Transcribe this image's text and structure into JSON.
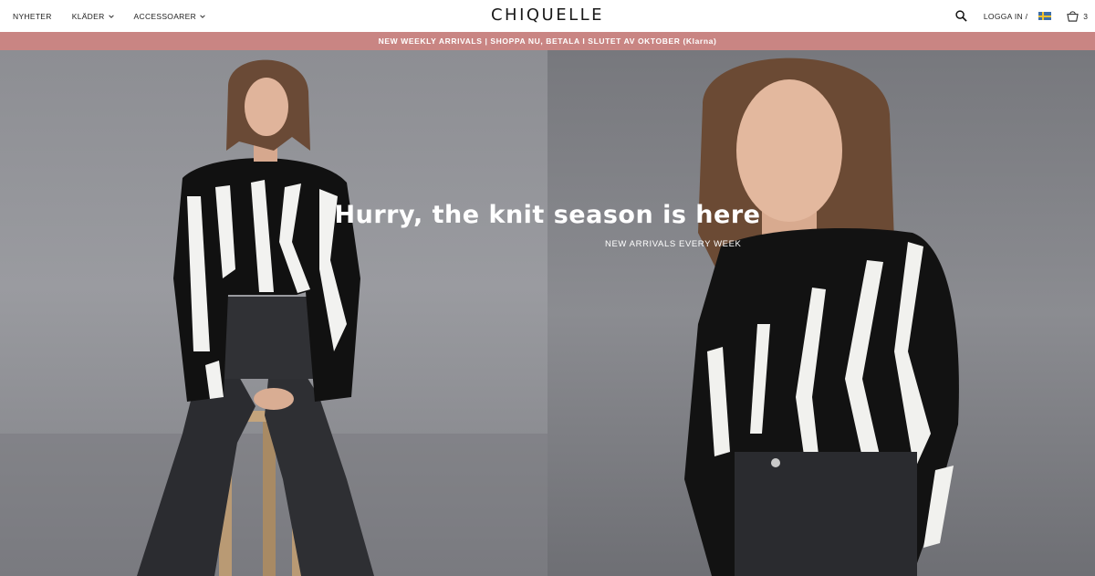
{
  "nav": {
    "items": [
      {
        "label": "NYHETER",
        "has_dropdown": false
      },
      {
        "label": "KLÄDER",
        "has_dropdown": true
      },
      {
        "label": "ACCESSOARER",
        "has_dropdown": true
      }
    ]
  },
  "brand": {
    "logo": "CHIQUELLE"
  },
  "tools": {
    "search_icon": "search-icon",
    "login_label": "LOGGA IN /",
    "flag": "sweden-flag-icon",
    "cart_icon": "shopping-bag-icon",
    "cart_count": "3"
  },
  "promo": {
    "text": "NEW WEEKLY ARRIVALS | SHOPPA NU, BETALA I SLUTET AV OKTOBER (Klarna)",
    "background": "#c98583"
  },
  "hero": {
    "title": "Hurry, the knit season is here",
    "subtitle": "NEW ARRIVALS EVERY WEEK"
  }
}
